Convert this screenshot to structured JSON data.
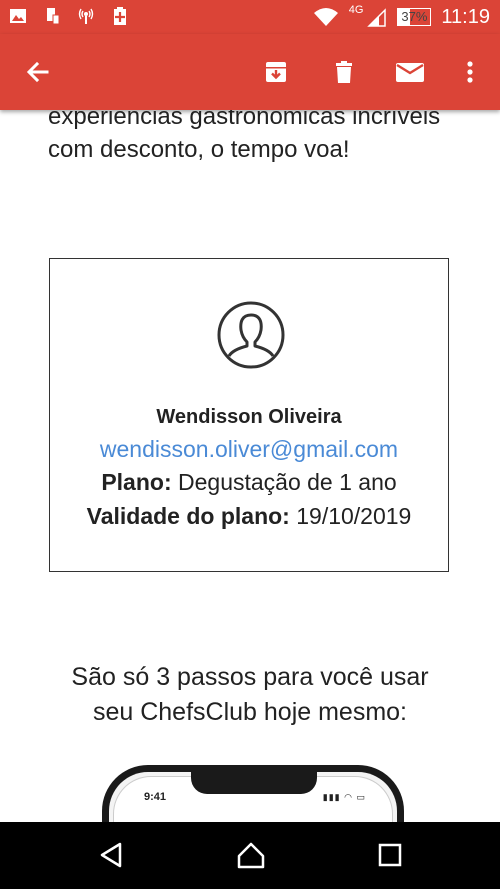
{
  "status_bar": {
    "network": "4G",
    "battery": "37%",
    "time": "11:19"
  },
  "toolbar": {
    "back_icon": "arrow-left-icon",
    "archive_icon": "archive-icon",
    "delete_icon": "trash-icon",
    "mark_unread_icon": "envelope-icon",
    "more_icon": "more-vert-icon"
  },
  "email": {
    "intro_text": "experiencias gastronomicas incríveis com desconto, o tempo voa!",
    "card": {
      "name": "Wendisson Oliveira",
      "email": "wendisson.oliver@gmail.com",
      "plan_label": "Plano:",
      "plan_value": " Degustação de 1 ano",
      "validity_label": "Validade do plano:",
      "validity_value": " 19/10/2019"
    },
    "steps_line1": "São só 3 passos para você usar",
    "steps_line2": "seu ChefsClub hoje mesmo:",
    "phone_time": "9:41"
  },
  "colors": {
    "accent": "#db4437",
    "link": "#4a8ad6"
  }
}
